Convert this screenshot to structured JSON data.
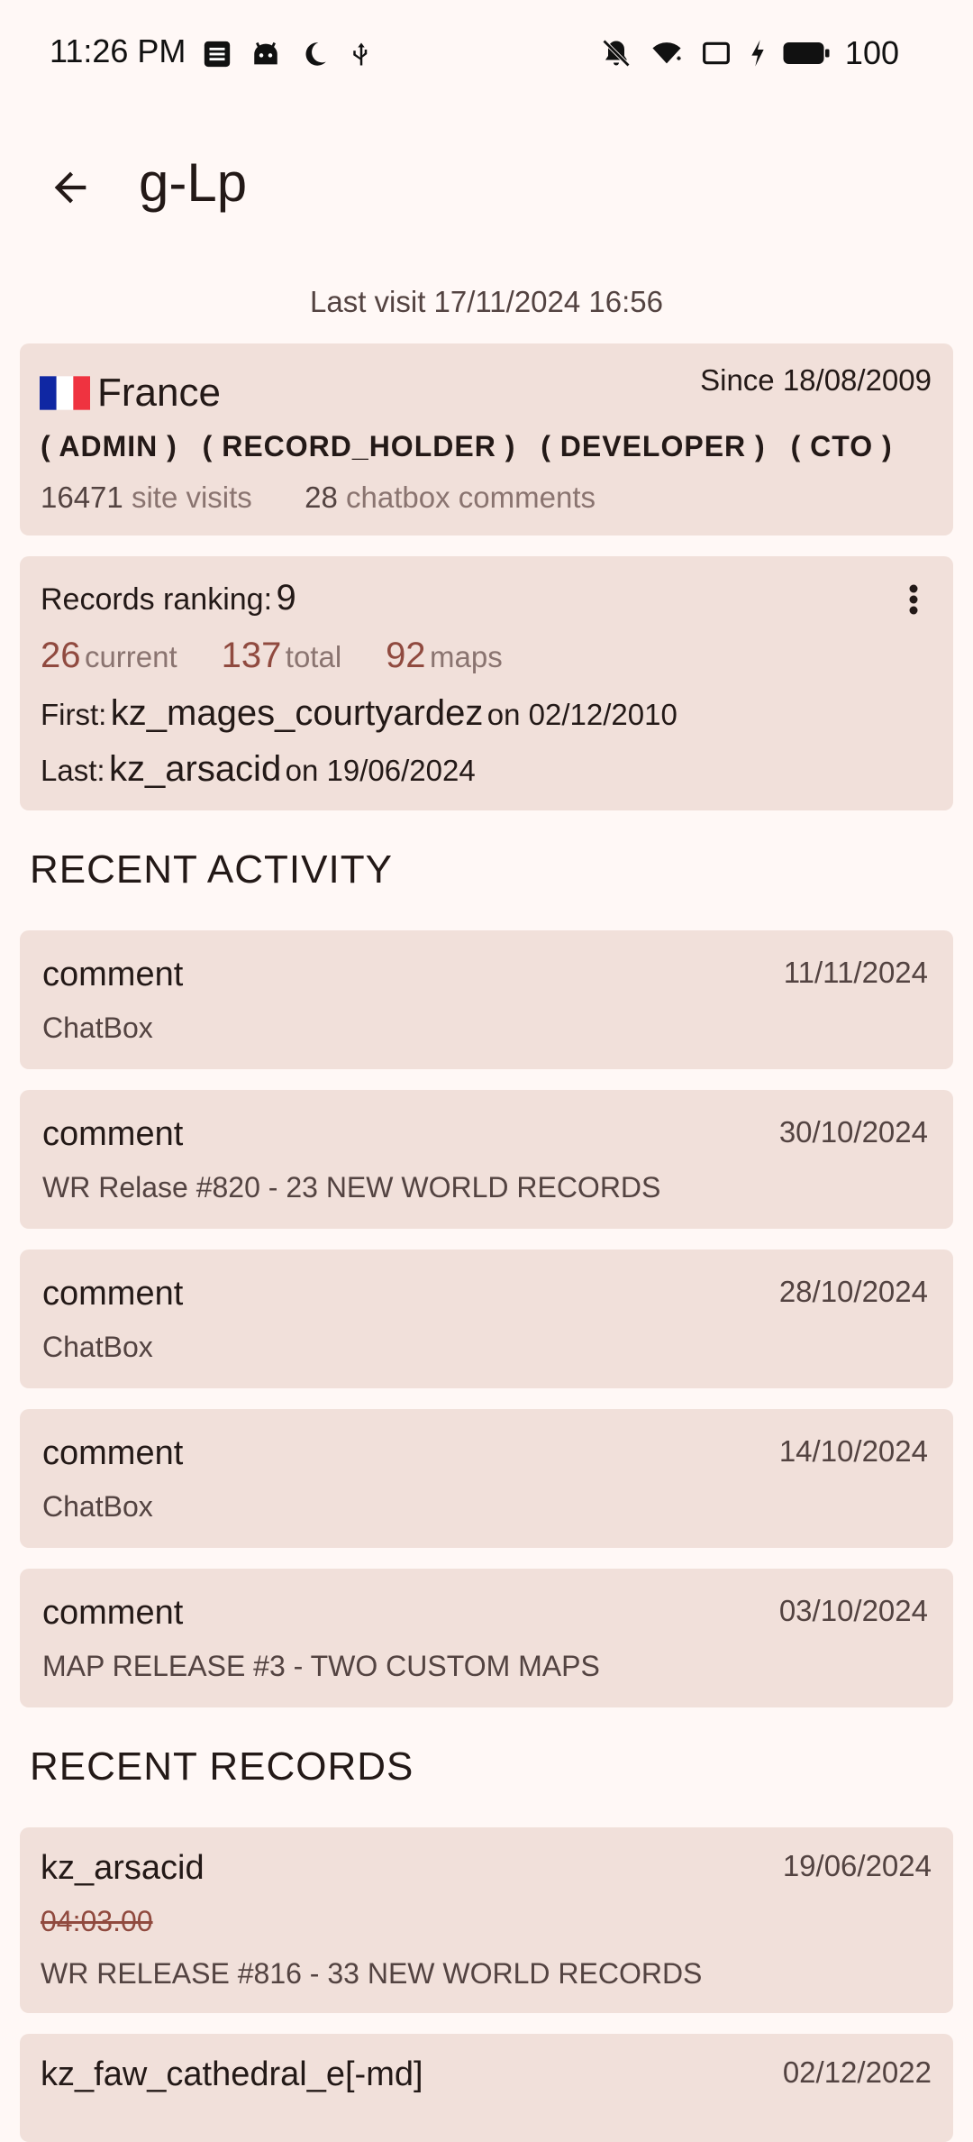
{
  "status_bar": {
    "time": "11:26 PM",
    "battery": "100"
  },
  "header": {
    "title": "g-Lp"
  },
  "last_visit": "Last visit 17/11/2024 16:56",
  "profile": {
    "country": "France",
    "since": "Since 18/08/2009",
    "roles": [
      "( ADMIN )",
      "( RECORD_HOLDER )",
      "( DEVELOPER )",
      "( CTO )"
    ],
    "site_visits_count": "16471",
    "site_visits_label": "site visits",
    "comments_count": "28",
    "comments_label": "chatbox comments"
  },
  "records": {
    "ranking_label": "Records ranking:",
    "ranking_value": "9",
    "current_count": "26",
    "current_label": "current",
    "total_count": "137",
    "total_label": "total",
    "maps_count": "92",
    "maps_label": "maps",
    "first_label": "First:",
    "first_map": "kz_mages_courtyardez",
    "first_on": "on 02/12/2010",
    "last_label": "Last:",
    "last_map": "kz_arsacid",
    "last_on": "on 19/06/2024"
  },
  "recent_activity": {
    "title": "RECENT ACTIVITY",
    "items": [
      {
        "type": "comment",
        "date": "11/11/2024",
        "subject": "ChatBox"
      },
      {
        "type": "comment",
        "date": "30/10/2024",
        "subject": "WR Relase #820 - 23 NEW WORLD RECORDS"
      },
      {
        "type": "comment",
        "date": "28/10/2024",
        "subject": "ChatBox"
      },
      {
        "type": "comment",
        "date": "14/10/2024",
        "subject": "ChatBox"
      },
      {
        "type": "comment",
        "date": "03/10/2024",
        "subject": "MAP RELEASE #3 - TWO CUSTOM MAPS"
      }
    ]
  },
  "recent_records": {
    "title": "RECENT RECORDS",
    "items": [
      {
        "map": "kz_arsacid",
        "date": "19/06/2024",
        "time": "04:03.00",
        "release": "WR RELEASE #816 - 33 NEW WORLD RECORDS"
      },
      {
        "map": "kz_faw_cathedral_e[-md]",
        "date": "02/12/2022"
      }
    ]
  },
  "colors": {
    "background": "#fff8f6",
    "card": "#f1e0da",
    "accent": "#904a3f"
  },
  "icons": [
    "back-arrow-icon",
    "more-vert-icon",
    "france-flag-icon"
  ]
}
